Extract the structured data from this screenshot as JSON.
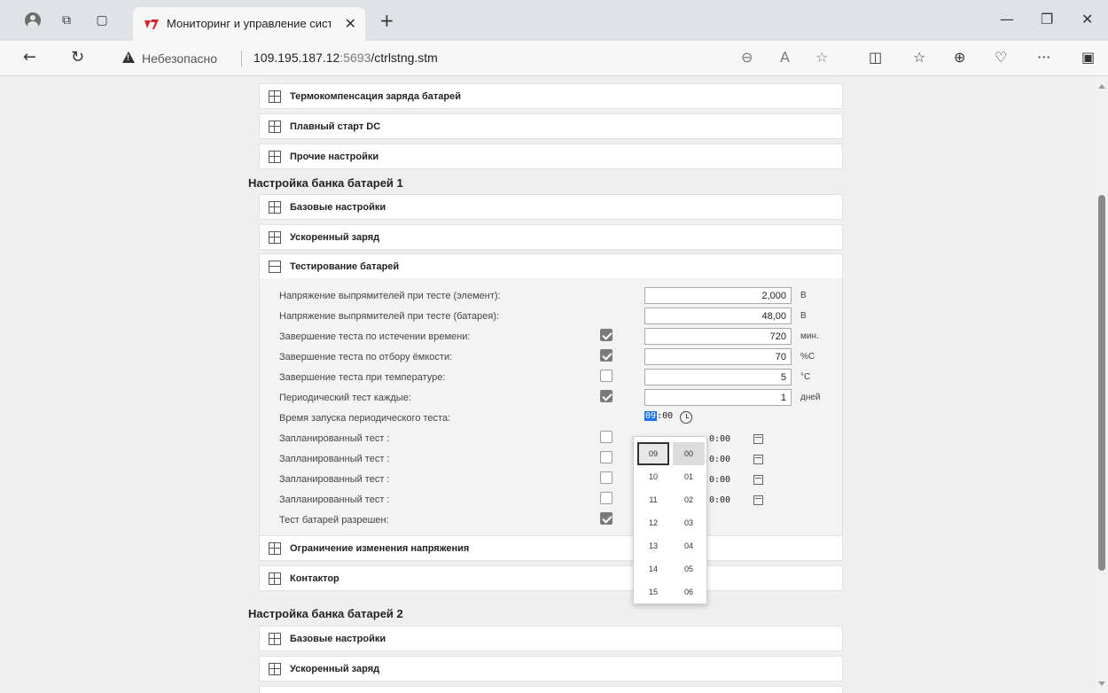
{
  "browser": {
    "tab_title": "Мониторинг и управление сист",
    "close": "✕",
    "new_tab": "+",
    "insecure_label": "Небезопасно",
    "url_host": "109.195.187.12",
    "url_port": ":5693",
    "url_path": "/ctrlstng.stm",
    "more": "···"
  },
  "page": {
    "panels_top": [
      "Термокомпенсация заряда батарей",
      "Плавный старт DC",
      "Прочие настройки"
    ],
    "bank1_title": "Настройка банка батарей 1",
    "bank1_panels": [
      "Базовые настройки",
      "Ускоренный заряд",
      "Тестирование батарей"
    ],
    "test": {
      "rows": [
        {
          "label": "Напряжение выпрямителей при тесте (элемент):",
          "value": "2,000",
          "unit": "В"
        },
        {
          "label": "Напряжение выпрямителей при тесте (батарея):",
          "value": "48,00",
          "unit": "В"
        },
        {
          "label": "Завершение теста по истечении времени:",
          "value": "720",
          "unit": "мин.",
          "checked": true
        },
        {
          "label": "Завершение теста по отбору ёмкости:",
          "value": "70",
          "unit": "%С",
          "checked": true
        },
        {
          "label": "Завершение теста при температуре:",
          "value": "5",
          "unit": "°С",
          "checked": false
        },
        {
          "label": "Периодический тест каждые:",
          "value": "1",
          "unit": "дней",
          "checked": true
        }
      ],
      "start_time_label": "Время запуска периодического теста:",
      "start_time_hh": "09",
      "start_time_mm": ":00",
      "scheduled_label": "Запланированный тест :",
      "scheduled_time": "0:00",
      "allowed_label": "Тест батарей разрешен:"
    },
    "bank1_panels_after": [
      "Ограничение изменения напряжения",
      "Контактор"
    ],
    "bank2_title": "Настройка банка батарей 2",
    "bank2_panels": [
      "Базовые настройки",
      "Ускоренный заряд"
    ]
  },
  "picker": {
    "hours": [
      "09",
      "10",
      "11",
      "12",
      "13",
      "14",
      "15"
    ],
    "minutes": [
      "00",
      "01",
      "02",
      "03",
      "04",
      "05",
      "06"
    ]
  }
}
